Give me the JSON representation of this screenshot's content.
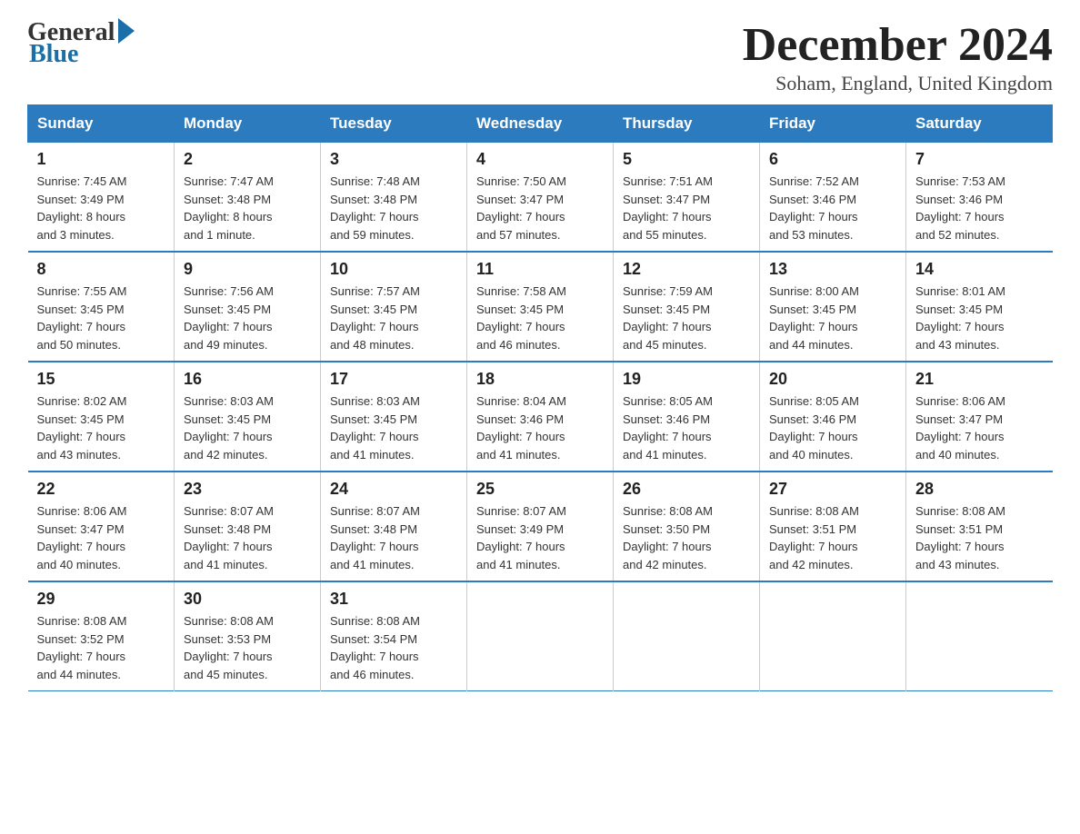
{
  "logo": {
    "general": "General",
    "blue": "Blue"
  },
  "title": "December 2024",
  "location": "Soham, England, United Kingdom",
  "headers": [
    "Sunday",
    "Monday",
    "Tuesday",
    "Wednesday",
    "Thursday",
    "Friday",
    "Saturday"
  ],
  "weeks": [
    [
      {
        "day": "1",
        "sunrise": "7:45 AM",
        "sunset": "3:49 PM",
        "daylight": "8 hours and 3 minutes."
      },
      {
        "day": "2",
        "sunrise": "7:47 AM",
        "sunset": "3:48 PM",
        "daylight": "8 hours and 1 minute."
      },
      {
        "day": "3",
        "sunrise": "7:48 AM",
        "sunset": "3:48 PM",
        "daylight": "7 hours and 59 minutes."
      },
      {
        "day": "4",
        "sunrise": "7:50 AM",
        "sunset": "3:47 PM",
        "daylight": "7 hours and 57 minutes."
      },
      {
        "day": "5",
        "sunrise": "7:51 AM",
        "sunset": "3:47 PM",
        "daylight": "7 hours and 55 minutes."
      },
      {
        "day": "6",
        "sunrise": "7:52 AM",
        "sunset": "3:46 PM",
        "daylight": "7 hours and 53 minutes."
      },
      {
        "day": "7",
        "sunrise": "7:53 AM",
        "sunset": "3:46 PM",
        "daylight": "7 hours and 52 minutes."
      }
    ],
    [
      {
        "day": "8",
        "sunrise": "7:55 AM",
        "sunset": "3:45 PM",
        "daylight": "7 hours and 50 minutes."
      },
      {
        "day": "9",
        "sunrise": "7:56 AM",
        "sunset": "3:45 PM",
        "daylight": "7 hours and 49 minutes."
      },
      {
        "day": "10",
        "sunrise": "7:57 AM",
        "sunset": "3:45 PM",
        "daylight": "7 hours and 48 minutes."
      },
      {
        "day": "11",
        "sunrise": "7:58 AM",
        "sunset": "3:45 PM",
        "daylight": "7 hours and 46 minutes."
      },
      {
        "day": "12",
        "sunrise": "7:59 AM",
        "sunset": "3:45 PM",
        "daylight": "7 hours and 45 minutes."
      },
      {
        "day": "13",
        "sunrise": "8:00 AM",
        "sunset": "3:45 PM",
        "daylight": "7 hours and 44 minutes."
      },
      {
        "day": "14",
        "sunrise": "8:01 AM",
        "sunset": "3:45 PM",
        "daylight": "7 hours and 43 minutes."
      }
    ],
    [
      {
        "day": "15",
        "sunrise": "8:02 AM",
        "sunset": "3:45 PM",
        "daylight": "7 hours and 43 minutes."
      },
      {
        "day": "16",
        "sunrise": "8:03 AM",
        "sunset": "3:45 PM",
        "daylight": "7 hours and 42 minutes."
      },
      {
        "day": "17",
        "sunrise": "8:03 AM",
        "sunset": "3:45 PM",
        "daylight": "7 hours and 41 minutes."
      },
      {
        "day": "18",
        "sunrise": "8:04 AM",
        "sunset": "3:46 PM",
        "daylight": "7 hours and 41 minutes."
      },
      {
        "day": "19",
        "sunrise": "8:05 AM",
        "sunset": "3:46 PM",
        "daylight": "7 hours and 41 minutes."
      },
      {
        "day": "20",
        "sunrise": "8:05 AM",
        "sunset": "3:46 PM",
        "daylight": "7 hours and 40 minutes."
      },
      {
        "day": "21",
        "sunrise": "8:06 AM",
        "sunset": "3:47 PM",
        "daylight": "7 hours and 40 minutes."
      }
    ],
    [
      {
        "day": "22",
        "sunrise": "8:06 AM",
        "sunset": "3:47 PM",
        "daylight": "7 hours and 40 minutes."
      },
      {
        "day": "23",
        "sunrise": "8:07 AM",
        "sunset": "3:48 PM",
        "daylight": "7 hours and 41 minutes."
      },
      {
        "day": "24",
        "sunrise": "8:07 AM",
        "sunset": "3:48 PM",
        "daylight": "7 hours and 41 minutes."
      },
      {
        "day": "25",
        "sunrise": "8:07 AM",
        "sunset": "3:49 PM",
        "daylight": "7 hours and 41 minutes."
      },
      {
        "day": "26",
        "sunrise": "8:08 AM",
        "sunset": "3:50 PM",
        "daylight": "7 hours and 42 minutes."
      },
      {
        "day": "27",
        "sunrise": "8:08 AM",
        "sunset": "3:51 PM",
        "daylight": "7 hours and 42 minutes."
      },
      {
        "day": "28",
        "sunrise": "8:08 AM",
        "sunset": "3:51 PM",
        "daylight": "7 hours and 43 minutes."
      }
    ],
    [
      {
        "day": "29",
        "sunrise": "8:08 AM",
        "sunset": "3:52 PM",
        "daylight": "7 hours and 44 minutes."
      },
      {
        "day": "30",
        "sunrise": "8:08 AM",
        "sunset": "3:53 PM",
        "daylight": "7 hours and 45 minutes."
      },
      {
        "day": "31",
        "sunrise": "8:08 AM",
        "sunset": "3:54 PM",
        "daylight": "7 hours and 46 minutes."
      },
      null,
      null,
      null,
      null
    ]
  ],
  "labels": {
    "sunrise": "Sunrise:",
    "sunset": "Sunset:",
    "daylight": "Daylight:"
  }
}
